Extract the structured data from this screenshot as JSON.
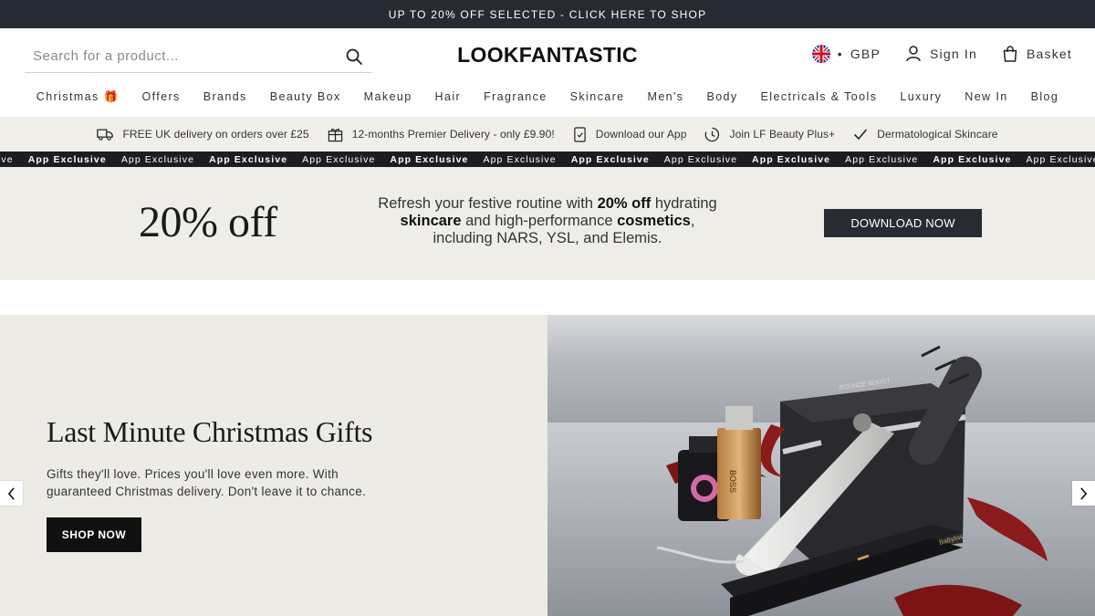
{
  "top_banner": {
    "text": "UP TO 20% OFF SELECTED - CLICK HERE TO SHOP"
  },
  "header": {
    "search_placeholder": "Search for a product...",
    "logo": "LOOKFANTASTIC",
    "currency": "GBP",
    "currency_separator": "•",
    "sign_in": "Sign In",
    "basket": "Basket"
  },
  "nav": {
    "items": [
      {
        "label": "Christmas 🎁"
      },
      {
        "label": "Offers"
      },
      {
        "label": "Brands"
      },
      {
        "label": "Beauty Box"
      },
      {
        "label": "Makeup"
      },
      {
        "label": "Hair"
      },
      {
        "label": "Fragrance"
      },
      {
        "label": "Skincare"
      },
      {
        "label": "Men's"
      },
      {
        "label": "Body"
      },
      {
        "label": "Electricals & Tools"
      },
      {
        "label": "Luxury"
      },
      {
        "label": "New In"
      },
      {
        "label": "Blog"
      }
    ]
  },
  "usp": {
    "items": [
      {
        "icon": "delivery-truck-icon",
        "label": "FREE UK delivery on orders over £25"
      },
      {
        "icon": "gift-box-icon",
        "label": "12-months Premier Delivery - only £9.90!"
      },
      {
        "icon": "phone-app-icon",
        "label": "Download our App"
      },
      {
        "icon": "loyalty-clock-icon",
        "label": "Join LF Beauty Plus+"
      },
      {
        "icon": "checkmark-icon",
        "label": "Dermatological Skincare"
      }
    ]
  },
  "ticker": {
    "lead": "ive",
    "bold_text": "App Exclusive",
    "regular_text": "App Exclusive",
    "tail": "Ap"
  },
  "promo": {
    "headline": "20% off",
    "copy_1": "Refresh your festive routine with ",
    "copy_bold_1": "20% off",
    "copy_2": " hydrating",
    "copy_bold_2": "skincare",
    "copy_3": " and high-performance ",
    "copy_bold_3": "cosmetics",
    "copy_4": ",",
    "copy_5": "including NARS, YSL, and Elemis.",
    "button": "DOWNLOAD NOW"
  },
  "hero": {
    "title": "Last Minute Christmas Gifts",
    "subtitle": "Gifts they'll love. Prices you'll love even more. With guaranteed Christmas delivery. Don't leave it to chance.",
    "button": "SHOP NOW",
    "image_labels": {
      "dryer_brand": "BOUNCE BOOST",
      "perfume": "BOSS",
      "straightener": "BaByliss"
    }
  },
  "colors": {
    "dark_bar": "#262a33",
    "usp_bg": "#f1efea",
    "promo_bg": "#efede8",
    "hero_bg": "#edebe5",
    "ribbon": "#8b1a1a"
  }
}
